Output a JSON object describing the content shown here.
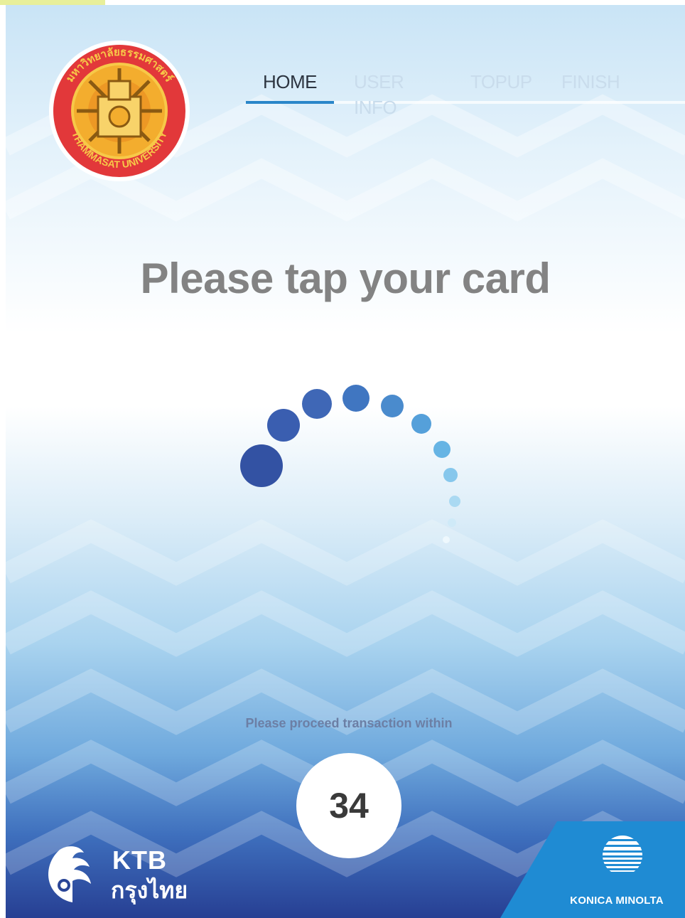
{
  "header": {
    "logo": {
      "name": "thammasat-university-seal",
      "text_top": "มหาวิทยาลัยธรรมศาสตร์",
      "text_bottom": "THAMMASAT UNIVERSITY"
    }
  },
  "nav": {
    "tabs": [
      {
        "label": "HOME",
        "active": true
      },
      {
        "label": "USER INFO",
        "active": false
      },
      {
        "label": "TOPUP",
        "active": false
      },
      {
        "label": "FINISH",
        "active": false
      }
    ]
  },
  "main": {
    "title": "Please tap your card",
    "spinner_icon": "loading-spinner-icon"
  },
  "timer": {
    "label": "Please proceed transaction within",
    "seconds": "34"
  },
  "footer": {
    "ktb": {
      "line1": "KTB",
      "line2": "กรุงไทย"
    },
    "konica": {
      "label": "KONICA MINOLTA"
    }
  },
  "colors": {
    "accent": "#2a86c9",
    "spinner_dark": "#3352a3",
    "konica_blue": "#1f8bd3"
  }
}
